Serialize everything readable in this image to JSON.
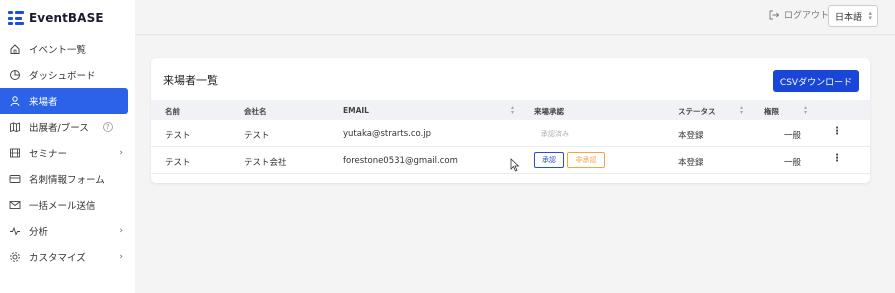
{
  "app": {
    "logo_text": "EventBASE",
    "brand_color": "#1a4fd8",
    "accent_color": "#2b62e8"
  },
  "sidebar": {
    "items": [
      {
        "label": "イベント一覧",
        "icon": "home-icon"
      },
      {
        "label": "ダッシュボード",
        "icon": "pie-chart-icon"
      },
      {
        "label": "来場者",
        "icon": "user-icon",
        "active": true
      },
      {
        "label": "出展者/ブース",
        "icon": "map-icon",
        "help": "?"
      },
      {
        "label": "セミナー",
        "icon": "film-icon",
        "caret": "›"
      },
      {
        "label": "名刺情報フォーム",
        "icon": "card-icon"
      },
      {
        "label": "一括メール送信",
        "icon": "mail-icon"
      },
      {
        "label": "分析",
        "icon": "activity-icon",
        "caret": "›"
      },
      {
        "label": "カスタマイズ",
        "icon": "gear-icon",
        "caret": "›"
      }
    ]
  },
  "topbar": {
    "logout_label": "ログアウト",
    "language": "日本語"
  },
  "main": {
    "title": "来場者一覧",
    "csv_button": "CSVダウンロード",
    "columns": [
      "名前",
      "会社名",
      "EMAIL",
      "来場承認",
      "ステータス",
      "権限"
    ],
    "rows": [
      {
        "name": "テスト",
        "company": "テスト",
        "email": "yutaka@strarts.co.jp",
        "approval_status": "承認済み",
        "status": "本登録",
        "role": "一般"
      },
      {
        "name": "テスト",
        "company": "テスト会社",
        "email": "forestone0531@gmail.com",
        "approve_label": "承認",
        "reject_label": "非承認",
        "status": "本登録",
        "role": "一般"
      }
    ],
    "menu_glyph": "⋮"
  }
}
